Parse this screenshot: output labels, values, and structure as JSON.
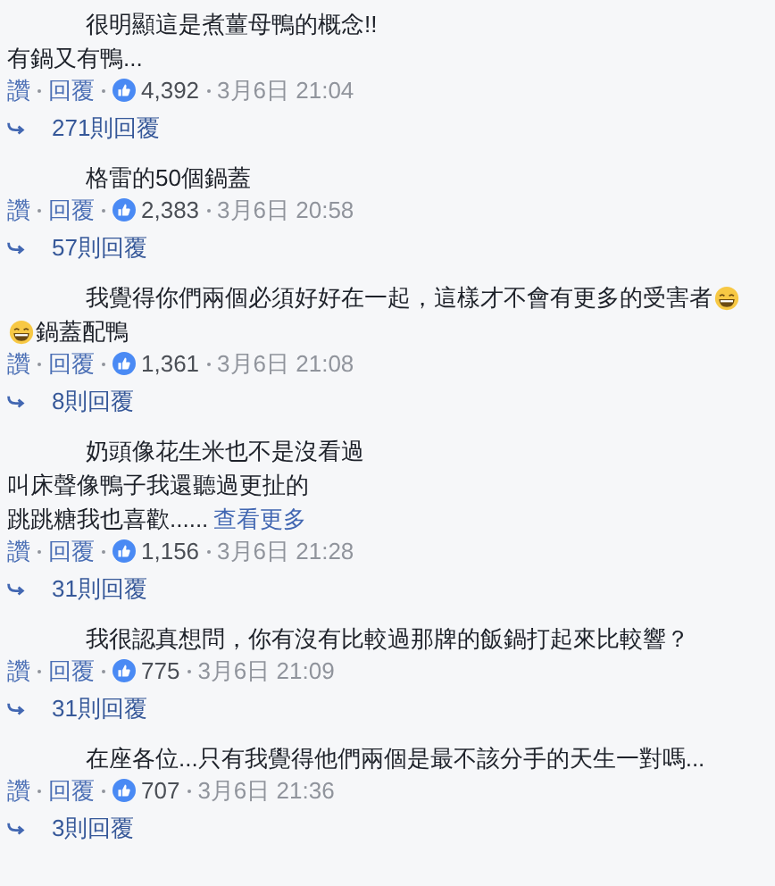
{
  "comments": [
    {
      "lines": [
        [
          {
            "kind": "text",
            "text": "很明顯這是煮薑母鴨的概念!!"
          }
        ],
        [
          {
            "kind": "text",
            "text": "有鍋又有鴨..."
          }
        ]
      ],
      "like": "讚",
      "reply": "回覆",
      "reactions": "4,392",
      "time": "3月6日 21:04",
      "replies": "271則回覆"
    },
    {
      "lines": [
        [
          {
            "kind": "text",
            "text": "格雷的50個鍋蓋"
          }
        ]
      ],
      "like": "讚",
      "reply": "回覆",
      "reactions": "2,383",
      "time": "3月6日 20:58",
      "replies": "57則回覆"
    },
    {
      "lines": [
        [
          {
            "kind": "text",
            "text": "我覺得你們兩個必須好好在一起，這樣才不會有更多的受害者"
          },
          {
            "kind": "emoji"
          }
        ],
        [
          {
            "kind": "emoji"
          },
          {
            "kind": "text",
            "text": "鍋蓋配鴨"
          }
        ]
      ],
      "like": "讚",
      "reply": "回覆",
      "reactions": "1,361",
      "time": "3月6日 21:08",
      "replies": "8則回覆"
    },
    {
      "lines": [
        [
          {
            "kind": "text",
            "text": "奶頭像花生米也不是沒看過"
          }
        ],
        [
          {
            "kind": "text",
            "text": "叫床聲像鴨子我還聽過更扯的"
          }
        ],
        [
          {
            "kind": "text",
            "text": "跳跳糖我也喜歡......"
          },
          {
            "kind": "link",
            "text": "查看更多"
          }
        ]
      ],
      "like": "讚",
      "reply": "回覆",
      "reactions": "1,156",
      "time": "3月6日 21:28",
      "replies": "31則回覆"
    },
    {
      "lines": [
        [
          {
            "kind": "text",
            "text": "我很認真想問，你有沒有比較過那牌的飯鍋打起來比較響？"
          }
        ]
      ],
      "like": "讚",
      "reply": "回覆",
      "reactions": "775",
      "time": "3月6日 21:09",
      "replies": "31則回覆"
    },
    {
      "lines": [
        [
          {
            "kind": "text",
            "text": "在座各位...只有我覺得他們兩個是最不該分手的天生一對嗎..."
          }
        ]
      ],
      "like": "讚",
      "reply": "回覆",
      "reactions": "707",
      "time": "3月6日 21:36",
      "replies": "3則回覆"
    }
  ]
}
